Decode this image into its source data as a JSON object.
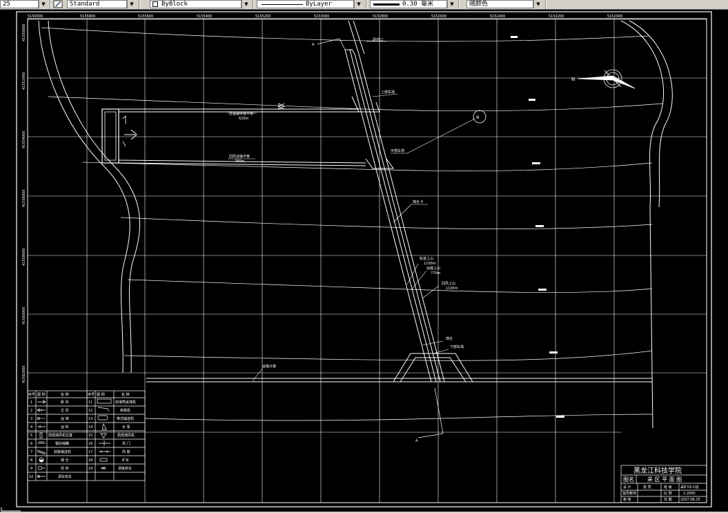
{
  "toolbar": {
    "scale_value": "25",
    "textstyle_value": "Standard",
    "layer_value": "ByBlock",
    "linetype_value": "ByLayer",
    "lineweight_value": "0.30 毫米",
    "color_value": "随颜色"
  },
  "colors": {
    "canvas": "#000000",
    "line": "#ffffff",
    "grid": "#ffffff"
  },
  "coords_top": [
    "5150000",
    "5155800",
    "5155600",
    "5155400",
    "5155200",
    "5153000",
    "5152800",
    "5152600",
    "5152400",
    "5152200",
    "5152000"
  ],
  "coords_left": [
    "41550000",
    "41552000",
    "41554000",
    "41556000",
    "41558000",
    "41560000",
    "41562000"
  ],
  "labels": {
    "north": "N",
    "section_a_top": "A",
    "section_a_bottom": "A",
    "road_top": "副井口",
    "upper_yard": "上部车场",
    "roadway_a": "主运输大巷平巷",
    "roadway_a_len": "620m",
    "roadway_b": "回风运输平巷",
    "roadway_b_len": "780m",
    "mid_yard": "中部车场",
    "coal_bin": "煤仓 4",
    "slope_1": "轨道上山",
    "slope_1_len": "1100m",
    "slope_2": "运输上山",
    "slope_2_len": "770m",
    "slope_3": "回风上山",
    "slope_3_len": "1100m",
    "lower_store": "煤仓",
    "lower_yard": "下部车场",
    "bottom_roadway": "运输大巷",
    "circle_mark": "N"
  },
  "legend": {
    "headers": [
      "序号",
      "图 例",
      "名 称"
    ],
    "rows": [
      {
        "no": "1",
        "name": "新 风",
        "no2": "11",
        "name2": "双滚筒采煤机"
      },
      {
        "no": "2",
        "name": "乏 风",
        "no2": "12",
        "name2": "转载机"
      },
      {
        "no": "3",
        "name": "运 煤",
        "no2": "13",
        "name2": "带式输送机"
      },
      {
        "no": "4",
        "name": "运 料",
        "no2": "14",
        "name2": "水 泵"
      },
      {
        "no": "5",
        "name": "局部通风机位置",
        "no2": "15",
        "name2": "局部通风机"
      },
      {
        "no": "6",
        "name": "钢丝绳罐",
        "no2": "16",
        "name2": "风 门"
      },
      {
        "no": "7",
        "name": "刮板输送机",
        "no2": "17",
        "name2": "风 窗"
      },
      {
        "no": "8",
        "name": "煤 仓",
        "no2": "18",
        "name2": "矿车"
      },
      {
        "no": "9",
        "name": "风 桥",
        "no2": "19",
        "name2": "调度绞车"
      },
      {
        "no": "10",
        "name": "调车绞车",
        "no2": "",
        "name2": ""
      }
    ]
  },
  "title_block": {
    "school": "黑龙江科技学院",
    "name_label": "图名",
    "name_value": "采 区 平 面 图",
    "r1": [
      "设 计",
      "张 亮",
      "班 级",
      "采矿03-1班"
    ],
    "r2": [
      "指导教师",
      "",
      "比 例",
      "1:2000"
    ],
    "r3": [
      "审 核",
      "",
      "日 期",
      "2007.06.25"
    ]
  }
}
